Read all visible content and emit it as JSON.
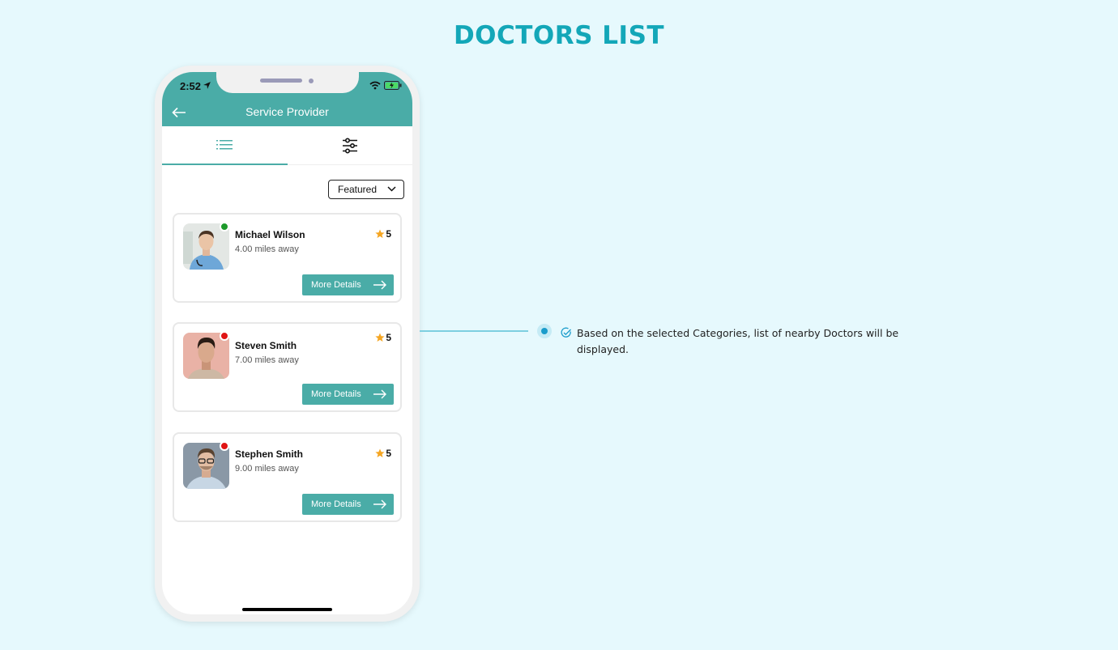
{
  "page": {
    "title": "DOCTORS LIST"
  },
  "status_bar": {
    "time": "2:52"
  },
  "header": {
    "title": "Service Provider"
  },
  "tabs": [
    {
      "name": "list-view",
      "icon": "list-icon",
      "active": true
    },
    {
      "name": "filters",
      "icon": "sliders-icon",
      "active": false
    }
  ],
  "sort": {
    "selected": "Featured"
  },
  "doctors": [
    {
      "name": "Michael Wilson",
      "distance": "4.00 miles away",
      "rating": "5",
      "status": "online",
      "status_color": "#1d9a2b",
      "button": "More Details"
    },
    {
      "name": "Steven Smith",
      "distance": "7.00 miles away",
      "rating": "5",
      "status": "offline",
      "status_color": "#e01414",
      "button": "More Details"
    },
    {
      "name": "Stephen Smith",
      "distance": "9.00 miles away",
      "rating": "5",
      "status": "offline",
      "status_color": "#e01414",
      "button": "More Details"
    }
  ],
  "annotation": {
    "text": "Based on the selected Categories, list of nearby Doctors will be displayed."
  },
  "colors": {
    "brand": "#4aaca7",
    "title": "#13a7b8",
    "star": "#f5a623"
  }
}
